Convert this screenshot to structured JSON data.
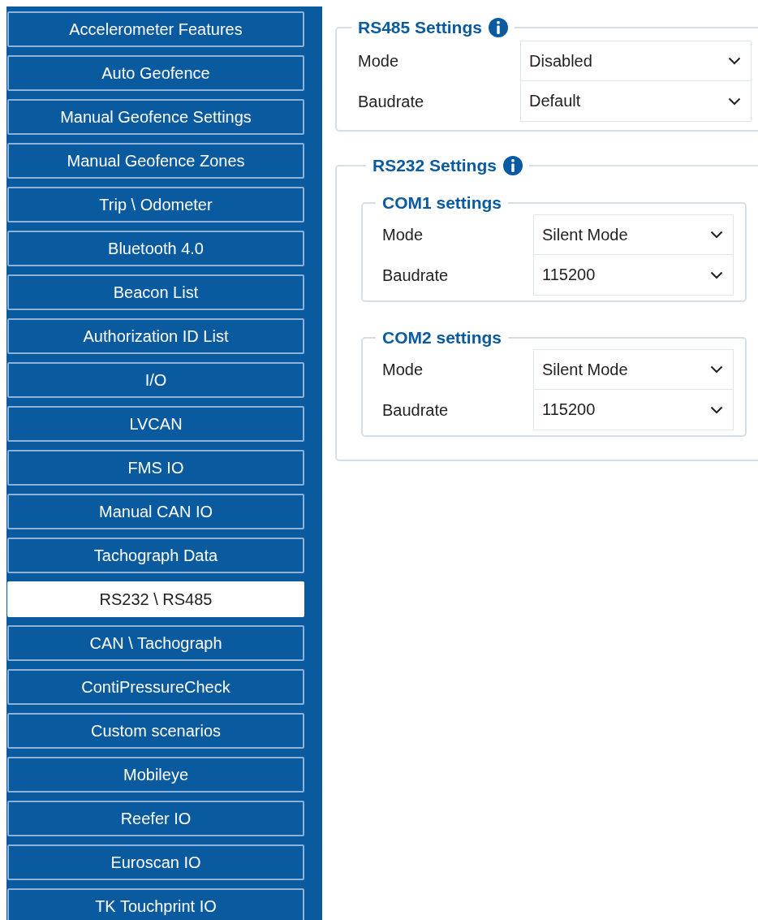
{
  "sidebar": {
    "items": [
      {
        "label": "Accelerometer Features",
        "selected": false
      },
      {
        "label": "Auto Geofence",
        "selected": false
      },
      {
        "label": "Manual Geofence Settings",
        "selected": false
      },
      {
        "label": "Manual Geofence Zones",
        "selected": false
      },
      {
        "label": "Trip \\ Odometer",
        "selected": false
      },
      {
        "label": "Bluetooth 4.0",
        "selected": false
      },
      {
        "label": "Beacon List",
        "selected": false
      },
      {
        "label": "Authorization ID List",
        "selected": false
      },
      {
        "label": "I/O",
        "selected": false
      },
      {
        "label": "LVCAN",
        "selected": false
      },
      {
        "label": "FMS IO",
        "selected": false
      },
      {
        "label": "Manual CAN IO",
        "selected": false
      },
      {
        "label": "Tachograph Data",
        "selected": false
      },
      {
        "label": "RS232 \\ RS485",
        "selected": true
      },
      {
        "label": "CAN \\ Tachograph",
        "selected": false
      },
      {
        "label": "ContiPressureCheck",
        "selected": false
      },
      {
        "label": "Custom scenarios",
        "selected": false
      },
      {
        "label": "Mobileye",
        "selected": false
      },
      {
        "label": "Reefer IO",
        "selected": false
      },
      {
        "label": "Euroscan IO",
        "selected": false
      },
      {
        "label": "TK Touchprint IO",
        "selected": false
      }
    ]
  },
  "rs485": {
    "title": "RS485 Settings",
    "fields": [
      {
        "label": "Mode",
        "value": "Disabled"
      },
      {
        "label": "Baudrate",
        "value": "Default"
      }
    ]
  },
  "rs232": {
    "title": "RS232 Settings",
    "groups": [
      {
        "title": "COM1 settings",
        "fields": [
          {
            "label": "Mode",
            "value": "Silent Mode"
          },
          {
            "label": "Baudrate",
            "value": "115200"
          }
        ]
      },
      {
        "title": "COM2 settings",
        "fields": [
          {
            "label": "Mode",
            "value": "Silent Mode"
          },
          {
            "label": "Baudrate",
            "value": "115200"
          }
        ]
      }
    ]
  }
}
